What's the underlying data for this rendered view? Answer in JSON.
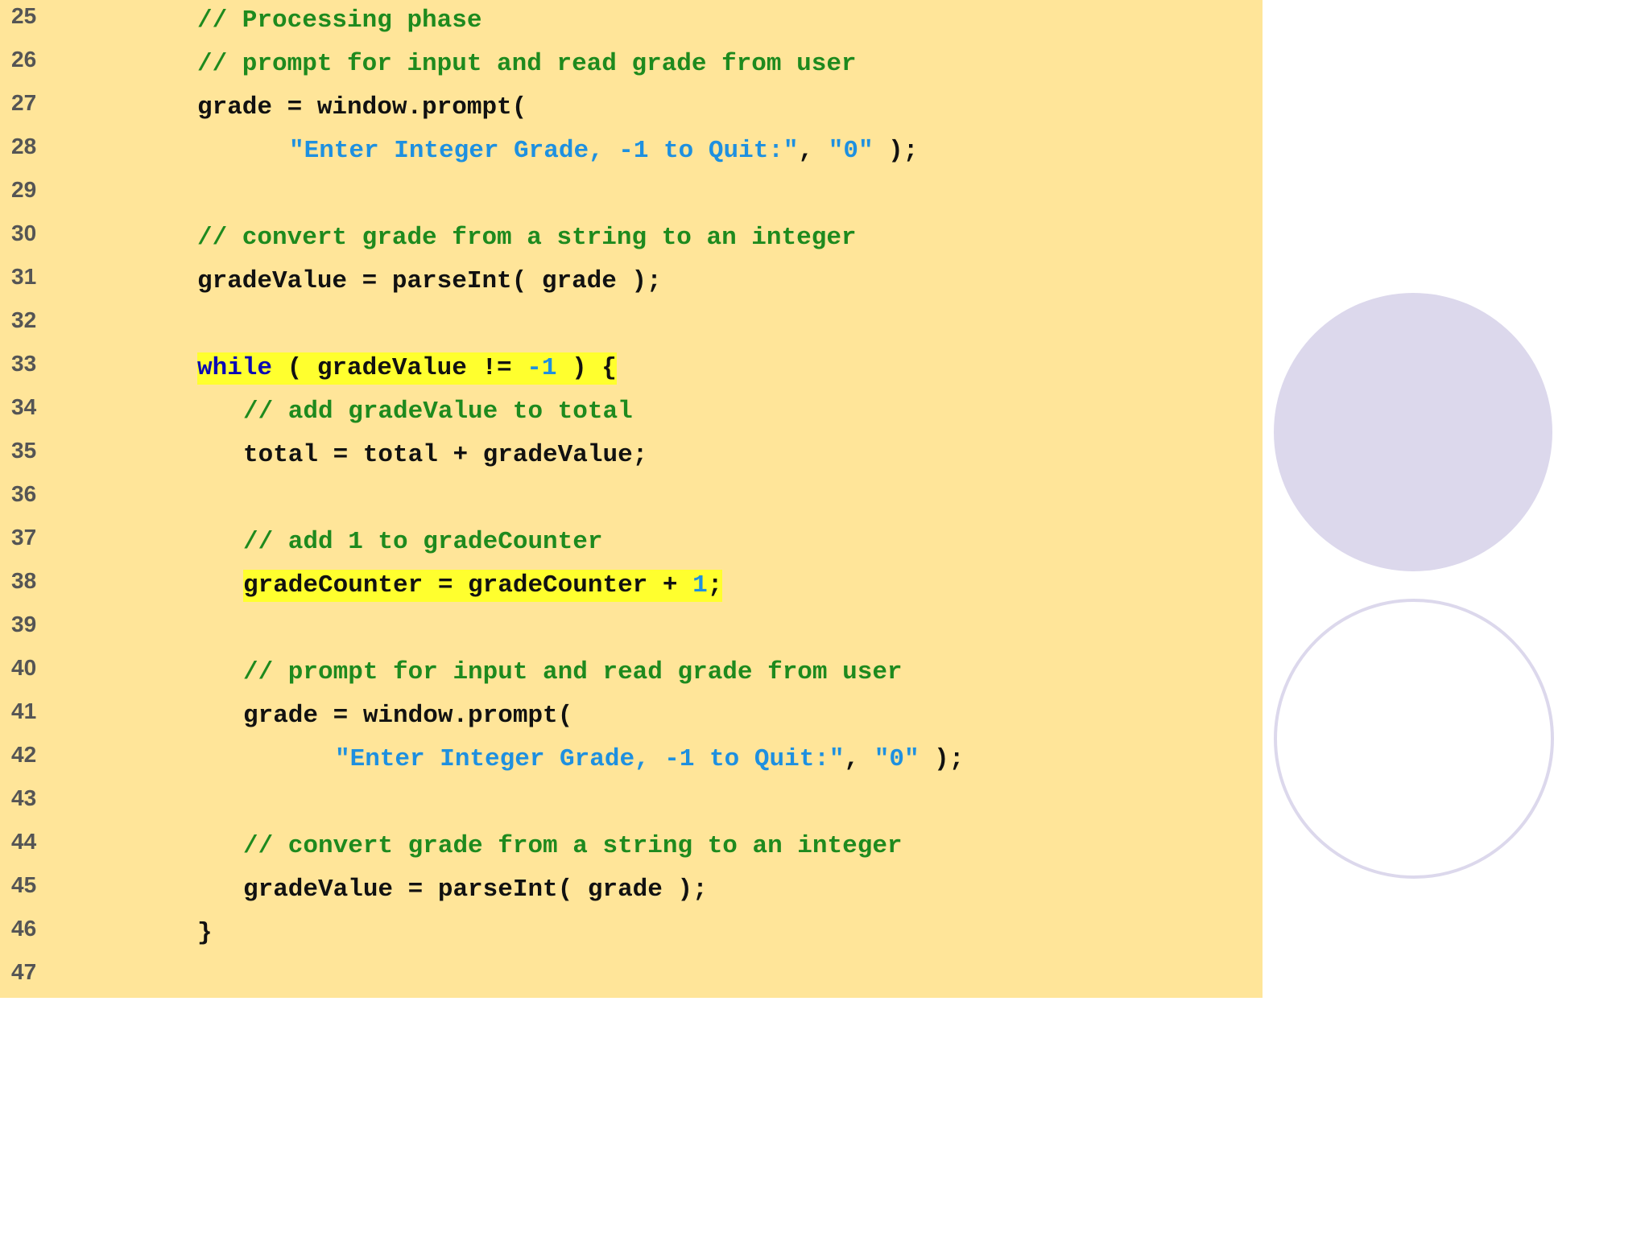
{
  "code_lines": [
    {
      "num": "25",
      "indent": 1,
      "tokens": [
        {
          "t": "comment",
          "v": "// Processing phase"
        }
      ]
    },
    {
      "num": "26",
      "indent": 1,
      "tokens": [
        {
          "t": "comment",
          "v": "// prompt for input and read grade from user"
        }
      ]
    },
    {
      "num": "27",
      "indent": 1,
      "tokens": [
        {
          "t": "plain",
          "v": "grade = window.prompt("
        }
      ]
    },
    {
      "num": "28",
      "indent": 2,
      "tokens": [
        {
          "t": "string",
          "v": "\"Enter Integer Grade, -1 to Quit:\""
        },
        {
          "t": "plain",
          "v": ", "
        },
        {
          "t": "string",
          "v": "\"0\""
        },
        {
          "t": "plain",
          "v": " );"
        }
      ]
    },
    {
      "num": "29",
      "indent": 0,
      "tokens": []
    },
    {
      "num": "30",
      "indent": 1,
      "tokens": [
        {
          "t": "comment",
          "v": "// convert grade from a string to an integer"
        }
      ]
    },
    {
      "num": "31",
      "indent": 1,
      "tokens": [
        {
          "t": "plain",
          "v": "gradeValue = parseInt( grade );"
        }
      ]
    },
    {
      "num": "32",
      "indent": 0,
      "tokens": []
    },
    {
      "num": "33",
      "indent": 1,
      "highlight": true,
      "tokens": [
        {
          "t": "keyword",
          "v": "while"
        },
        {
          "t": "plain",
          "v": " ( gradeValue != "
        },
        {
          "t": "number",
          "v": "-1"
        },
        {
          "t": "plain",
          "v": " ) {"
        }
      ]
    },
    {
      "num": "34",
      "indent": 1.5,
      "tokens": [
        {
          "t": "comment",
          "v": "// add gradeValue to total"
        }
      ]
    },
    {
      "num": "35",
      "indent": 1.5,
      "tokens": [
        {
          "t": "plain",
          "v": "total = total + gradeValue;"
        }
      ]
    },
    {
      "num": "36",
      "indent": 0,
      "tokens": []
    },
    {
      "num": "37",
      "indent": 1.5,
      "tokens": [
        {
          "t": "comment",
          "v": "// add 1 to gradeCounter"
        }
      ]
    },
    {
      "num": "38",
      "indent": 1.5,
      "highlight": true,
      "tokens": [
        {
          "t": "plain",
          "v": "gradeCounter = gradeCounter + "
        },
        {
          "t": "number",
          "v": "1"
        },
        {
          "t": "plain",
          "v": ";"
        }
      ]
    },
    {
      "num": "39",
      "indent": 0,
      "tokens": []
    },
    {
      "num": "40",
      "indent": 1.5,
      "tokens": [
        {
          "t": "comment",
          "v": "// prompt for input and read grade from user"
        }
      ]
    },
    {
      "num": "41",
      "indent": 1.5,
      "tokens": [
        {
          "t": "plain",
          "v": "grade = window.prompt("
        }
      ]
    },
    {
      "num": "42",
      "indent": 2.5,
      "tokens": [
        {
          "t": "string",
          "v": "\"Enter Integer Grade, -1 to Quit:\""
        },
        {
          "t": "plain",
          "v": ", "
        },
        {
          "t": "string",
          "v": "\"0\""
        },
        {
          "t": "plain",
          "v": " );"
        }
      ]
    },
    {
      "num": "43",
      "indent": 0,
      "tokens": []
    },
    {
      "num": "44",
      "indent": 1.5,
      "tokens": [
        {
          "t": "comment",
          "v": "// convert grade from a string to an integer"
        }
      ]
    },
    {
      "num": "45",
      "indent": 1.5,
      "tokens": [
        {
          "t": "plain",
          "v": "gradeValue = parseInt( grade );"
        }
      ]
    },
    {
      "num": "46",
      "indent": 1,
      "tokens": [
        {
          "t": "plain",
          "v": "}"
        }
      ]
    },
    {
      "num": "47",
      "indent": 0,
      "tokens": []
    }
  ],
  "colors": {
    "panel_background": "#ffe599",
    "comment": "#1e8a1e",
    "string": "#1e90e0",
    "keyword": "#0a0ab4",
    "highlight": "#ffff2e",
    "circle": "#dcd8ec"
  }
}
